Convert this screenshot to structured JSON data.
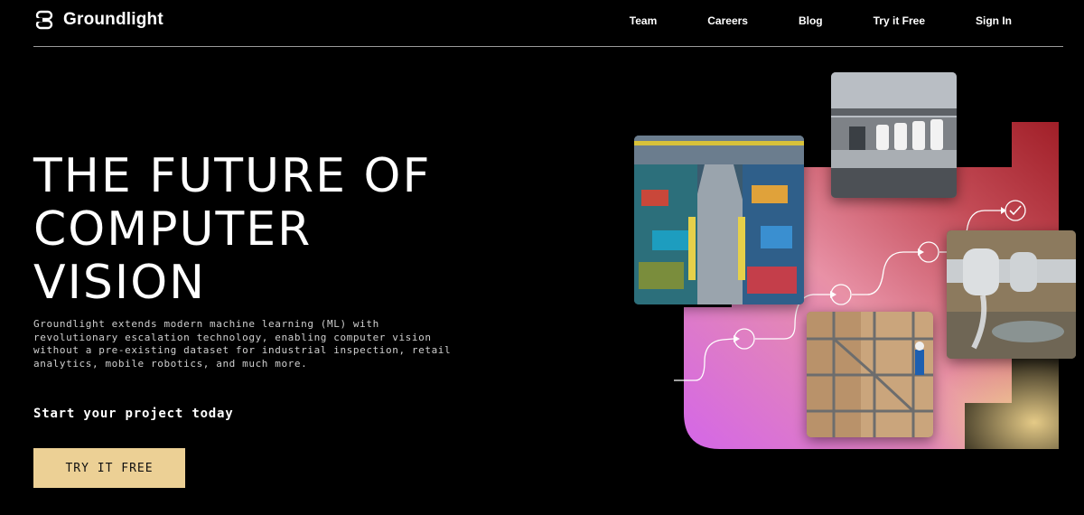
{
  "header": {
    "brand": "Groundlight",
    "nav": [
      "Team",
      "Careers",
      "Blog",
      "Try it Free",
      "Sign In"
    ]
  },
  "hero": {
    "title_lines": [
      "THE FUTURE OF",
      "COMPUTER",
      "VISION"
    ],
    "description": "Groundlight extends modern machine learning (ML) with revolutionary escalation technology, enabling computer vision without a pre-existing dataset for industrial inspection, retail analytics, mobile robotics, and much more.",
    "cta_heading": "Start your project today",
    "cta_button": "TRY IT FREE"
  },
  "colors": {
    "background": "#000000",
    "button": "#ecd095",
    "gradient_magenta": "#d466e8",
    "gradient_red": "#b8324a",
    "gradient_yellow": "#f1d58e"
  },
  "icons": [
    "groundlight-logo-icon",
    "check-circle-icon"
  ]
}
